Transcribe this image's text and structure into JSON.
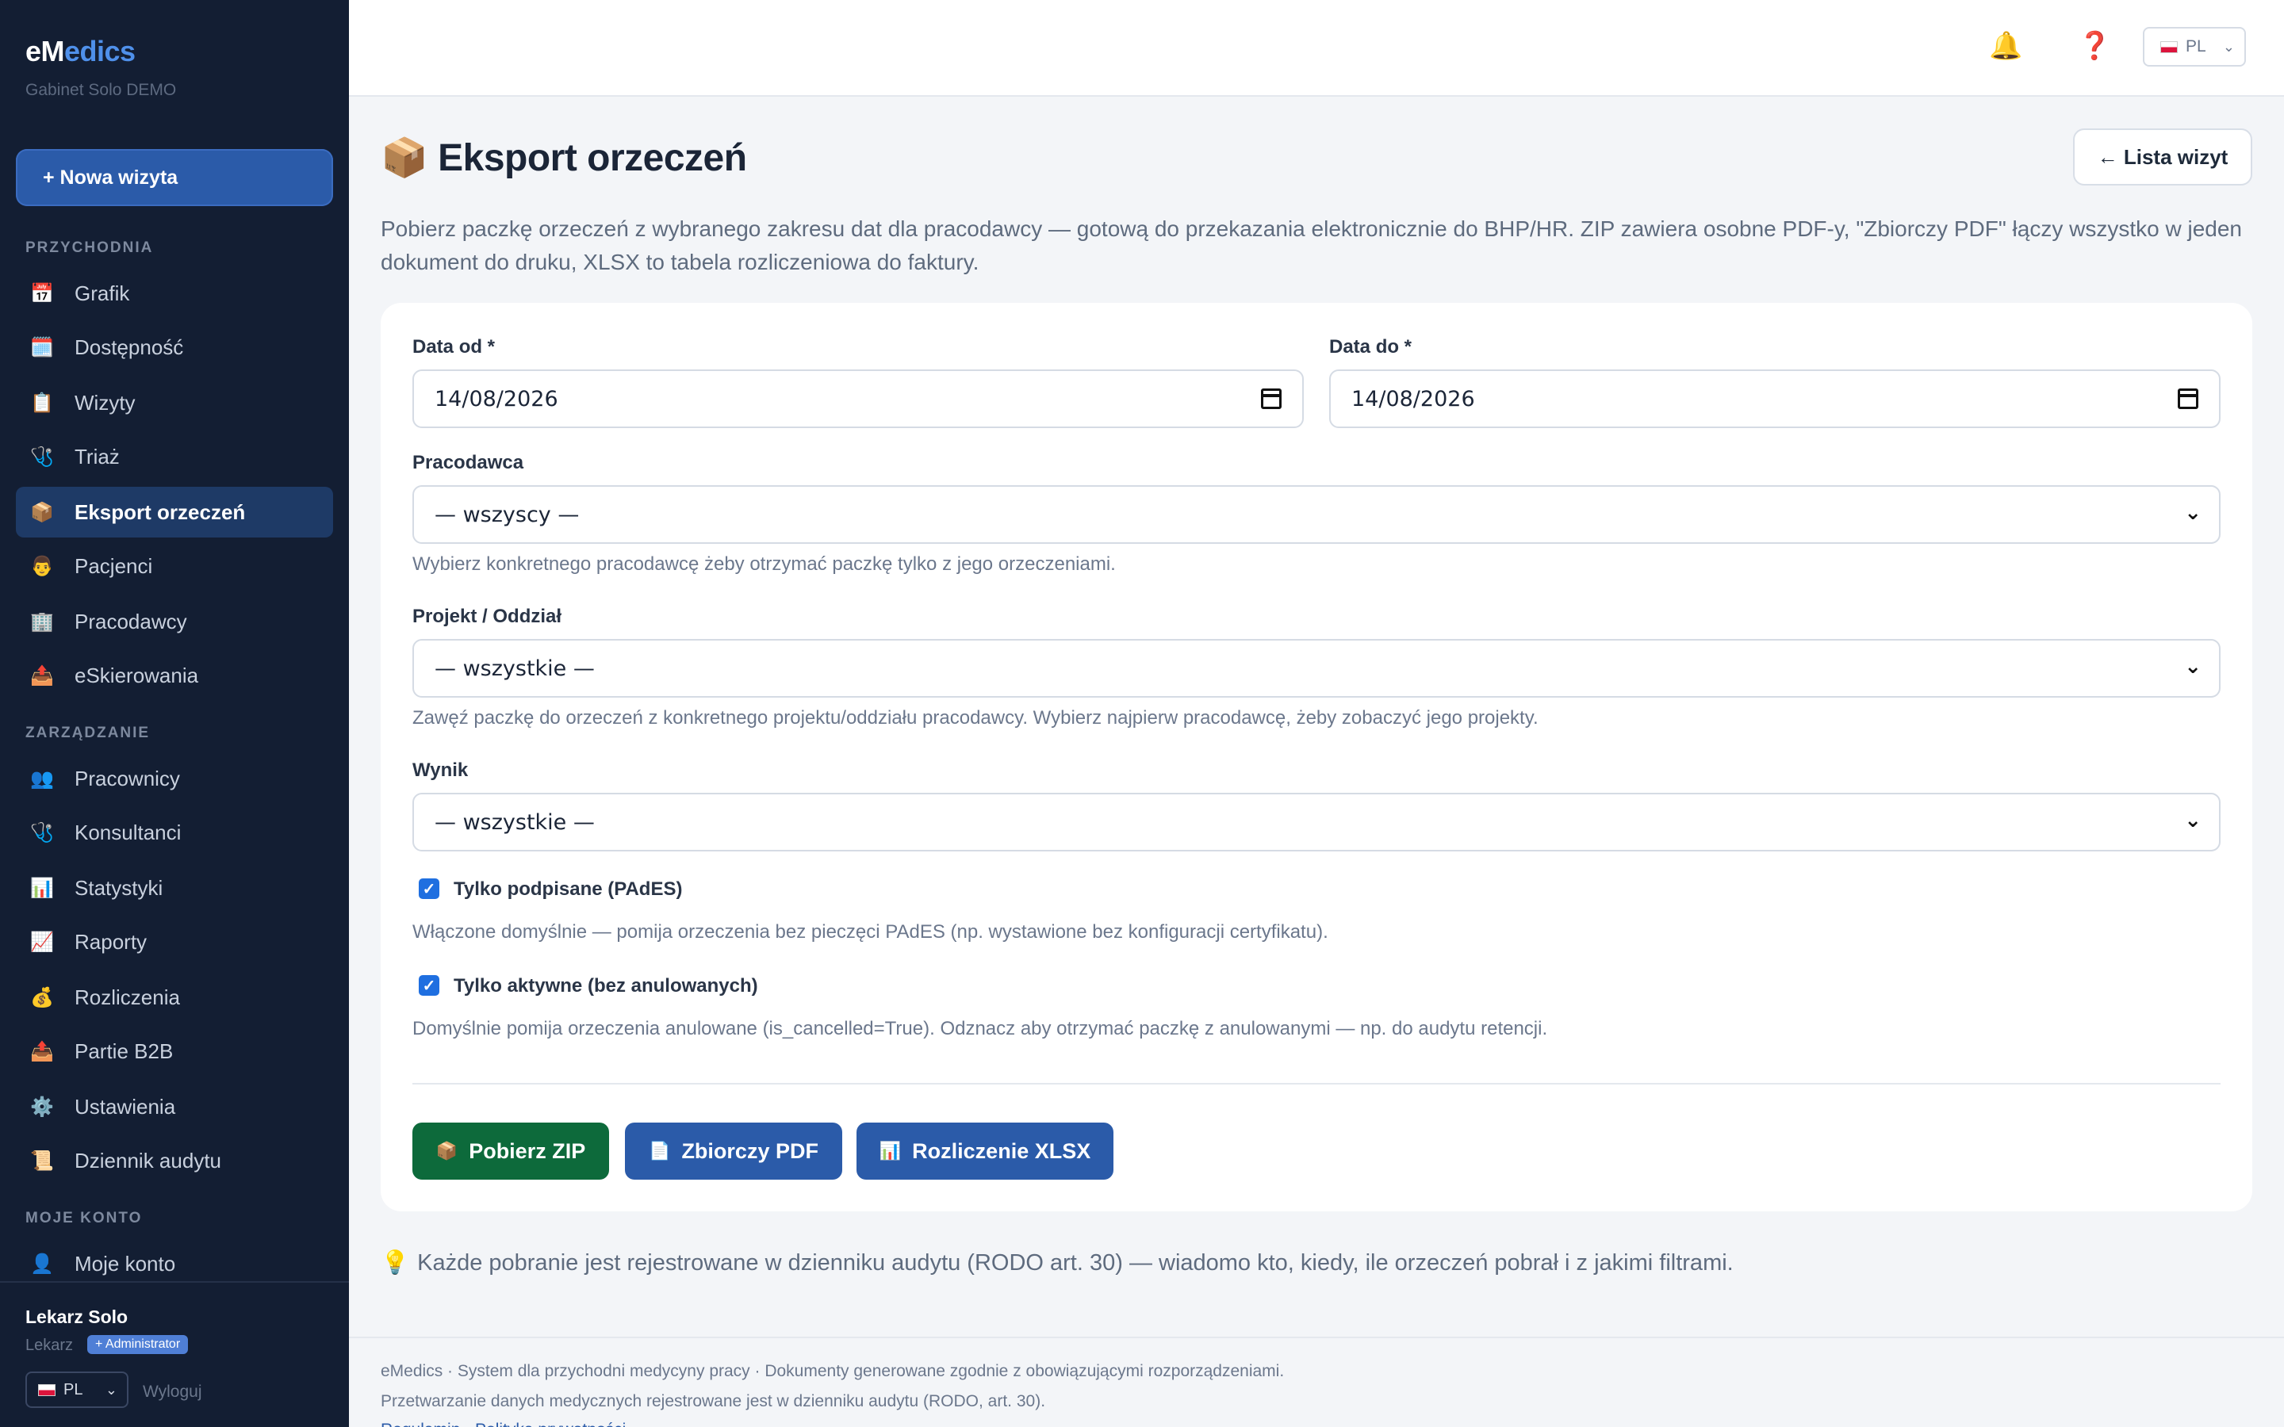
{
  "brand": {
    "prefix": "eM",
    "suffix": "edics",
    "subtitle": "Gabinet Solo DEMO"
  },
  "sidebar": {
    "new_visit": "+ Nowa wizyta",
    "sections": [
      "PRZYCHODNIA",
      "ZARZĄDZANIE",
      "MOJE KONTO"
    ],
    "items": [
      {
        "icon": "📅",
        "label": "Grafik"
      },
      {
        "icon": "🗓️",
        "label": "Dostępność"
      },
      {
        "icon": "📋",
        "label": "Wizyty"
      },
      {
        "icon": "🩺",
        "label": "Triaż"
      },
      {
        "icon": "📦",
        "label": "Eksport orzeczeń"
      },
      {
        "icon": "👨",
        "label": "Pacjenci"
      },
      {
        "icon": "🏢",
        "label": "Pracodawcy"
      },
      {
        "icon": "📤",
        "label": "eSkierowania"
      },
      {
        "icon": "👥",
        "label": "Pracownicy"
      },
      {
        "icon": "🩺",
        "label": "Konsultanci"
      },
      {
        "icon": "📊",
        "label": "Statystyki"
      },
      {
        "icon": "📈",
        "label": "Raporty"
      },
      {
        "icon": "💰",
        "label": "Rozliczenia"
      },
      {
        "icon": "📤",
        "label": "Partie B2B"
      },
      {
        "icon": "⚙️",
        "label": "Ustawienia"
      },
      {
        "icon": "📜",
        "label": "Dziennik audytu"
      },
      {
        "icon": "👤",
        "label": "Moje konto"
      }
    ],
    "user": {
      "name": "Lekarz Solo",
      "role": "Lekarz",
      "badge": "+ Administrator",
      "lang": "PL",
      "logout": "Wyloguj"
    }
  },
  "topbar": {
    "bell_icon": "🔔",
    "help_icon": "❓",
    "lang": "PL"
  },
  "page": {
    "icon": "📦",
    "title": "Eksport orzeczeń",
    "back_button": "← Lista wizyt",
    "lead": "Pobierz paczkę orzeczeń z wybranego zakresu dat dla pracodawcy — gotową do przekazania elektronicznie do BHP/HR. ZIP zawiera osobne PDF-y, \"Zbiorczy PDF\" łączy wszystko w jeden dokument do druku, XLSX to tabela rozliczeniowa do faktury."
  },
  "form": {
    "date_from": {
      "label": "Data od *",
      "value": "14/08/2026"
    },
    "date_to": {
      "label": "Data do *",
      "value": "14/08/2026"
    },
    "employer": {
      "label": "Pracodawca",
      "value": "— wszyscy —",
      "help": "Wybierz konkretnego pracodawcę żeby otrzymać paczkę tylko z jego orzeczeniami."
    },
    "project": {
      "label": "Projekt / Oddział",
      "value": "— wszystkie —",
      "help": "Zawęź paczkę do orzeczeń z konkretnego projektu/oddziału pracodawcy. Wybierz najpierw pracodawcę, żeby zobaczyć jego projekty."
    },
    "result": {
      "label": "Wynik",
      "value": "— wszystkie —"
    },
    "signed_only": {
      "label": "Tylko podpisane (PAdES)",
      "checked": true,
      "help": "Włączone domyślnie — pomija orzeczenia bez pieczęci PAdES (np. wystawione bez konfiguracji certyfikatu)."
    },
    "active_only": {
      "label": "Tylko aktywne (bez anulowanych)",
      "checked": true,
      "help": "Domyślnie pomija orzeczenia anulowane (is_cancelled=True). Odznacz aby otrzymać paczkę z anulowanymi — np. do audytu retencji."
    }
  },
  "actions": {
    "zip": {
      "icon": "📦",
      "label": "Pobierz ZIP"
    },
    "pdf": {
      "icon": "📄",
      "label": "Zbiorczy PDF"
    },
    "xlsx": {
      "icon": "📊",
      "label": "Rozliczenie XLSX"
    }
  },
  "note": {
    "icon": "💡",
    "text": "Każde pobranie jest rejestrowane w dzienniku audytu (RODO art. 30) — wiadomo kto, kiedy, ile orzeczeń pobrał i z jakimi filtrami."
  },
  "footer": {
    "line1": "eMedics · System dla przychodni medycyny pracy · Dokumenty generowane zgodnie z obowiązującymi rozporządzeniami.",
    "line2": "Przetwarzanie danych medycznych rejestrowane jest w dzienniku audytu (RODO, art. 30).",
    "line3": "Regulamin · Polityka prywatności"
  },
  "colors": {
    "sidebar_bg": "#131e33",
    "primary": "#2b5ba9",
    "success": "#0d6a3b",
    "checkbox": "#1f6fe0"
  }
}
